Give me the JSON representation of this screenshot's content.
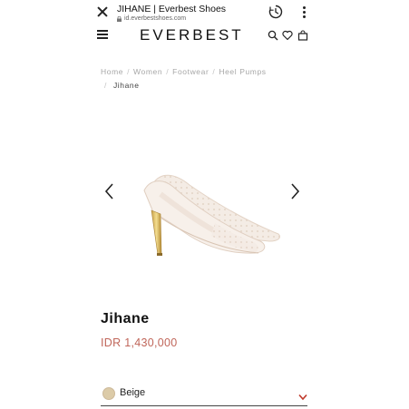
{
  "browser": {
    "title": "JIHANE | Everbest Shoes",
    "url": "id.everbestshoes.com"
  },
  "header": {
    "logo": "EVERBEST"
  },
  "breadcrumb": {
    "items": [
      "Home",
      "Women",
      "Footwear",
      "Heel Pumps"
    ],
    "current": "Jihane"
  },
  "product": {
    "name": "Jihane",
    "price": "IDR 1,430,000",
    "color": {
      "label": "Beige",
      "swatch": "#dccba8"
    }
  },
  "colors": {
    "price": "#c0665a",
    "chevron": "#c0392b"
  }
}
